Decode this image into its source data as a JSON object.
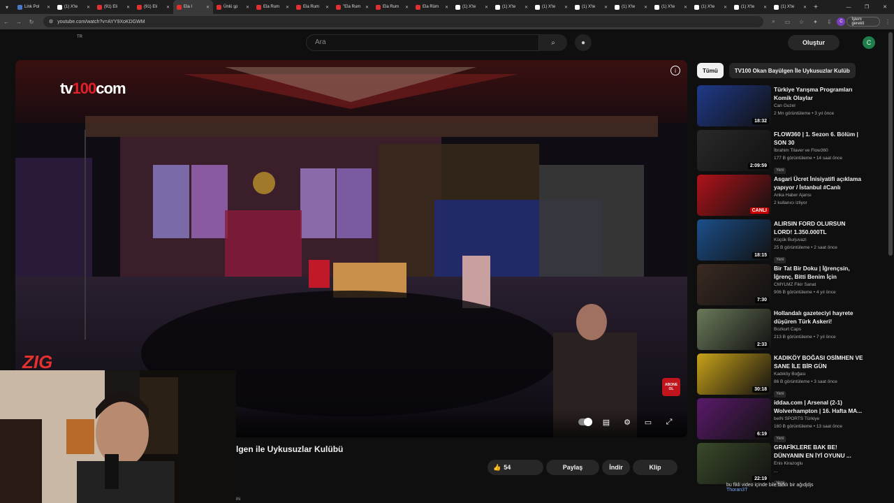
{
  "browser": {
    "tabs": [
      {
        "label": "Link Pol",
        "color": "#4a78c8",
        "active": false
      },
      {
        "label": "(1) X'te",
        "color": "#ffffff",
        "active": false
      },
      {
        "label": "(91) Eli",
        "color": "#e03030",
        "active": false
      },
      {
        "label": "(91) Eli",
        "color": "#e03030",
        "active": false
      },
      {
        "label": "Ela I",
        "color": "#e03030",
        "active": true
      },
      {
        "label": "Ünlü şp",
        "color": "#e03030",
        "active": false
      },
      {
        "label": "Ela Rum",
        "color": "#e03030",
        "active": false
      },
      {
        "label": "Ela Rum",
        "color": "#e03030",
        "active": false
      },
      {
        "label": "\"Ela Rum",
        "color": "#e03030",
        "active": false
      },
      {
        "label": "Ela Rum",
        "color": "#e03030",
        "active": false
      },
      {
        "label": "Ela Rüm",
        "color": "#e03030",
        "active": false
      },
      {
        "label": "(1) X'te",
        "color": "#ffffff",
        "active": false
      },
      {
        "label": "(1) X'te",
        "color": "#ffffff",
        "active": false
      },
      {
        "label": "(1) X'te",
        "color": "#ffffff",
        "active": false
      },
      {
        "label": "(1) X'te",
        "color": "#ffffff",
        "active": false
      },
      {
        "label": "(1) X'te",
        "color": "#ffffff",
        "active": false
      },
      {
        "label": "(1) X'te",
        "color": "#ffffff",
        "active": false
      },
      {
        "label": "(1) X'te",
        "color": "#ffffff",
        "active": false
      },
      {
        "label": "(1) X'te",
        "color": "#ffffff",
        "active": false
      },
      {
        "label": "(1) X'te",
        "color": "#ffffff",
        "active": false
      }
    ],
    "url": "youtube.com/watch?v=AYY9XoKDGWM",
    "profile_initial": "C",
    "status_label": "İşlem gerekli"
  },
  "header": {
    "country": "TR",
    "search_placeholder": "Ara",
    "create_label": "Oluştur",
    "avatar_initial": "C"
  },
  "player": {
    "logo_left": "tv",
    "logo_accent": "100",
    "logo_right": "com",
    "subscribe_badge": "ABONE OL",
    "streamer_logo": "ZIG"
  },
  "video": {
    "title_visible": "lgen ile Uykusuzlar Kulübü",
    "likes": "54",
    "share_label": "Paylaş",
    "download_label": "İndir",
    "clip_label": "Klip",
    "description_fragment": "ihi"
  },
  "chips": [
    {
      "label": "Tümü",
      "selected": true
    },
    {
      "label": "TV100 Okan Bayülgen İle Uykusuzlar Kulüb",
      "selected": false
    }
  ],
  "recommendations": [
    {
      "title": "Türkiye Yarışma Programları Komik Olaylar",
      "channel": "Can Guzel",
      "stats": "2 Mn görüntüleme • 3 yıl önce",
      "duration": "18:32",
      "badge": "",
      "thumb": "#1f3a8a"
    },
    {
      "title": "FLOW360 | 1. Sezon 6. Bölüm | SON 30",
      "channel": "İbrahim Tilaver  ve Flow360",
      "stats": "177 B görüntüleme • 14 saat önce",
      "duration": "2:09:59",
      "badge": "Yeni",
      "thumb": "#2a2a2a"
    },
    {
      "title": "Asgari Ücret İnisiyatifi açıklama yapıyor / İstanbul #Canlı",
      "channel": "Anka Haber Ajansı",
      "stats": "2 kullanıcı izliyor",
      "duration": "CANLI",
      "badge": "",
      "thumb": "#b0121a"
    },
    {
      "title": "ALIRSIN FORD OLURSUN LORD! 1.350.000TL",
      "channel": "Küçük Burjuvazi",
      "stats": "25 B görüntüleme • 2 saat önce",
      "duration": "18:15",
      "badge": "Yeni",
      "thumb": "#1b4f8a"
    },
    {
      "title": "Bir Tat Bir Doku | İğrençsin, İğrenç, Bitti Benim İçin",
      "channel": "CMYLMZ Fikir Sanat",
      "stats": "906 B görüntüleme • 4 yıl önce",
      "duration": "7:30",
      "badge": "",
      "thumb": "#3a2a22"
    },
    {
      "title": "Hollandalı gazeteciyi hayrete düşüren Türk Askeri!",
      "channel": "Bozkurt Caps",
      "stats": "213 B görüntüleme • 7 yıl önce",
      "duration": "2:33",
      "badge": "",
      "thumb": "#6b7a5a"
    },
    {
      "title": "KADIKÖY BOĞASI OSİMHEN VE SANE İLE BİR GÜN",
      "channel": "Kadıköy Boğası",
      "stats": "86 B görüntüleme • 3 saat önce",
      "duration": "30:18",
      "badge": "Yeni",
      "thumb": "#c8a21a"
    },
    {
      "title": "iddaa.com | Arsenal (2-1) Wolverhampton | 16. Hafta MA...",
      "channel": "beIN SPORTS Türkiye",
      "stats": "160 B görüntüleme • 13 saat önce",
      "duration": "6:19",
      "badge": "Yeni",
      "thumb": "#5a1a6a"
    },
    {
      "title": "GRAFİKLERE BAK BE! DÜNYANIN EN İYİ OYUNU ...",
      "channel": "Enis Kirazoglu",
      "stats": "...",
      "duration": "22:19",
      "badge": "Yeni",
      "thumb": "#3a4a2a"
    }
  ],
  "overlay": {
    "chat_line": "bu fikli video içinde bile farklı bir ağıdjdjs",
    "chat_user": "Thoran3T"
  }
}
